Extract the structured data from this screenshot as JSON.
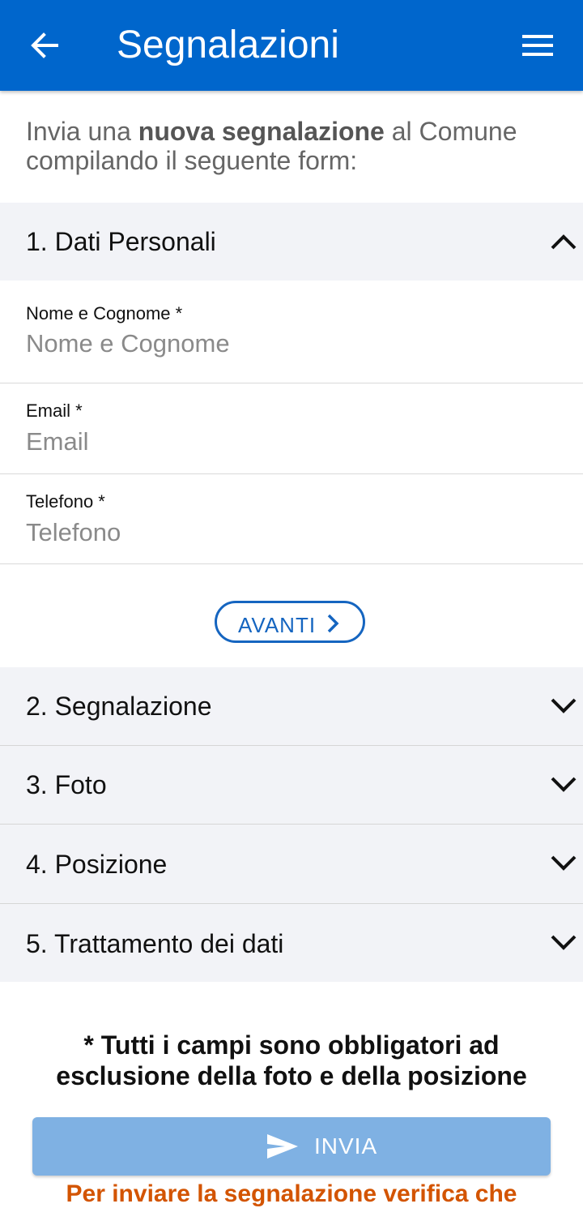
{
  "appbar": {
    "title": "Segnalazioni",
    "back_icon": "arrow-left-icon",
    "menu_icon": "hamburger-menu-icon",
    "color": "#0066cc"
  },
  "intro": {
    "prefix": "Invia una ",
    "bold": "nuova segnalazione",
    "suffix": " al Comune compilando il seguente form:"
  },
  "sections": [
    {
      "label": "1. Dati Personali",
      "expanded": true,
      "icon": "chevron-up-icon"
    },
    {
      "label": "2. Segnalazione",
      "expanded": false,
      "icon": "chevron-down-icon"
    },
    {
      "label": "3. Foto",
      "expanded": false,
      "icon": "chevron-down-icon"
    },
    {
      "label": "4. Posizione",
      "expanded": false,
      "icon": "chevron-down-icon"
    },
    {
      "label": "5. Trattamento dei dati",
      "expanded": false,
      "icon": "chevron-down-icon"
    }
  ],
  "fields": [
    {
      "label": "Nome e Cognome *",
      "placeholder": "Nome e Cognome",
      "value": ""
    },
    {
      "label": "Email *",
      "placeholder": "Email",
      "value": ""
    },
    {
      "label": "Telefono *",
      "placeholder": "Telefono",
      "value": ""
    }
  ],
  "next_button": {
    "label": "AVANTI",
    "icon": "chevron-right-icon",
    "color": "#1565c0"
  },
  "required_note": "* Tutti i campi sono obbligatori ad esclusione della foto e della posizione",
  "submit_button": {
    "label": "INVIA",
    "icon": "send-icon",
    "color": "#7fb1e3"
  },
  "warning": {
    "text": "Per inviare la segnalazione verifica che",
    "color": "#d35400"
  }
}
